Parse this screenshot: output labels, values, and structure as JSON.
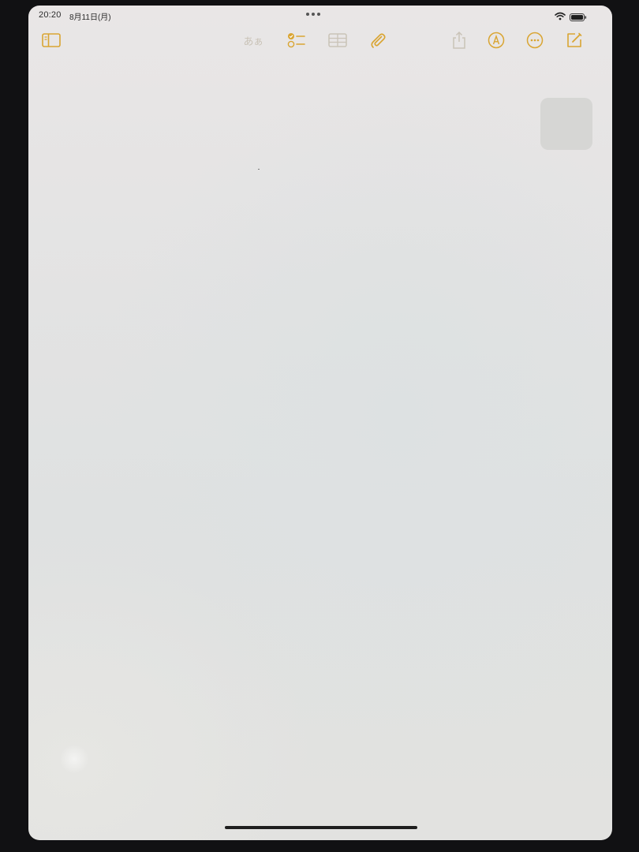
{
  "status_bar": {
    "time": "20:20",
    "date": "8月11日(月)",
    "wifi_icon": "wifi-icon",
    "battery_icon": "battery-icon"
  },
  "toolbar": {
    "sidebar_icon": "sidebar-toggle-icon",
    "format_label": "あぁ",
    "checklist_icon": "checklist-icon",
    "table_icon": "table-icon",
    "attachment_icon": "paperclip-icon",
    "share_icon": "share-icon",
    "markup_icon": "markup-pen-icon",
    "more_icon": "more-ellipsis-icon",
    "compose_icon": "compose-icon"
  },
  "colors": {
    "accent": "#d9a532",
    "disabled": "#c9c3b7",
    "status_text": "#2b2b2b",
    "note_background": "#e4e4e3"
  },
  "note": {
    "content": ""
  }
}
